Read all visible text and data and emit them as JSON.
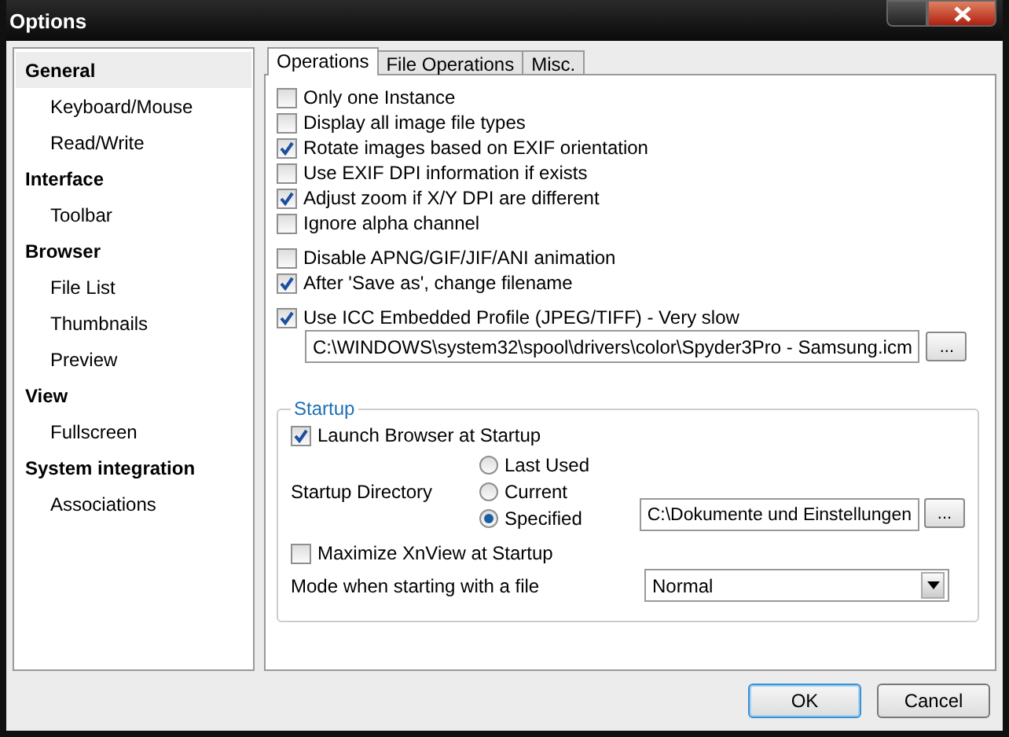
{
  "window": {
    "title": "Options"
  },
  "sidebar": {
    "items": [
      {
        "label": "General",
        "selected": true,
        "children": [
          {
            "label": "Keyboard/Mouse",
            "selected": false
          },
          {
            "label": "Read/Write",
            "selected": false
          }
        ]
      },
      {
        "label": "Interface",
        "selected": false,
        "children": [
          {
            "label": "Toolbar",
            "selected": false
          }
        ]
      },
      {
        "label": "Browser",
        "selected": false,
        "children": [
          {
            "label": "File List",
            "selected": false
          },
          {
            "label": "Thumbnails",
            "selected": false
          },
          {
            "label": "Preview",
            "selected": false
          }
        ]
      },
      {
        "label": "View",
        "selected": false,
        "children": [
          {
            "label": "Fullscreen",
            "selected": false
          }
        ]
      },
      {
        "label": "System integration",
        "selected": false,
        "children": [
          {
            "label": "Associations",
            "selected": false
          }
        ]
      }
    ]
  },
  "tabs": [
    {
      "label": "Operations",
      "selected": true
    },
    {
      "label": "File Operations",
      "selected": false
    },
    {
      "label": "Misc.",
      "selected": false
    }
  ],
  "option_groups": [
    [
      {
        "label": "Only one Instance",
        "checked": false
      },
      {
        "label": "Display all image file types",
        "checked": false
      },
      {
        "label": "Rotate images based on EXIF orientation",
        "checked": true
      },
      {
        "label": "Use EXIF DPI information if exists",
        "checked": false
      },
      {
        "label": "Adjust zoom if X/Y DPI are different",
        "checked": true
      },
      {
        "label": "Ignore alpha channel",
        "checked": false
      }
    ],
    [
      {
        "label": "Disable APNG/GIF/JIF/ANI animation",
        "checked": false
      },
      {
        "label": "After 'Save as', change filename",
        "checked": true
      }
    ],
    [
      {
        "label": "Use ICC Embedded Profile (JPEG/TIFF) - Very slow",
        "checked": true
      }
    ]
  ],
  "icc_profile": {
    "value": "C:\\WINDOWS\\system32\\spool\\drivers\\color\\Spyder3Pro - Samsung.icm",
    "browse": "..."
  },
  "startup": {
    "title": "Startup",
    "launch_browser": {
      "label": "Launch Browser at Startup",
      "checked": true
    },
    "directory_label": "Startup Directory",
    "directory_options": [
      {
        "label": "Last Used",
        "selected": false
      },
      {
        "label": "Current",
        "selected": false
      },
      {
        "label": "Specified",
        "selected": true
      }
    ],
    "directory_path": {
      "value": "C:\\Dokumente und Einstellungen",
      "browse": "..."
    },
    "maximize": {
      "label": "Maximize XnView at Startup",
      "checked": false
    },
    "mode_label": "Mode when starting with a file",
    "mode_value": "Normal"
  },
  "buttons": [
    {
      "label": "OK",
      "default": true
    },
    {
      "label": "Cancel",
      "default": false
    }
  ]
}
